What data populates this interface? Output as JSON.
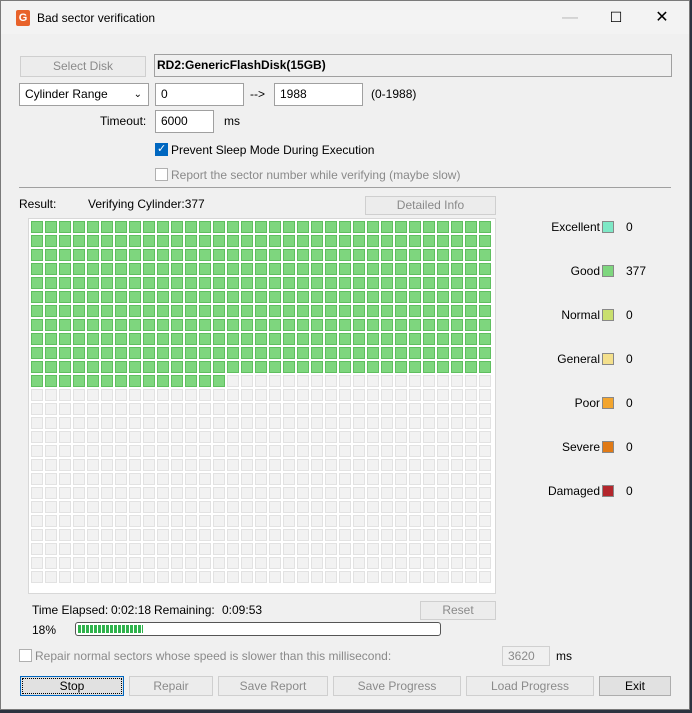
{
  "window": {
    "title": "Bad sector verification"
  },
  "controls": {
    "select_disk": "Select Disk",
    "disk_name": "RD2:GenericFlashDisk(15GB)",
    "range_mode": "Cylinder Range",
    "range_start": "0",
    "arrow": "-->",
    "range_end": "1988",
    "range_hint": "(0-1988)",
    "timeout_label": "Timeout:",
    "timeout_value": "6000",
    "timeout_unit": "ms",
    "prevent_sleep": "Prevent Sleep Mode During Execution",
    "report_sector": "Report the sector number while verifying (maybe slow)"
  },
  "result": {
    "label": "Result:",
    "status": "Verifying Cylinder:377",
    "detailed_info": "Detailed Info",
    "grid": {
      "columns": 33,
      "rows": 26,
      "good_cells": 377
    }
  },
  "legend": [
    {
      "label": "Excellent",
      "count": "0",
      "color": "#7ee8c6"
    },
    {
      "label": "Good",
      "count": "377",
      "color": "#7ed67e"
    },
    {
      "label": "Normal",
      "count": "0",
      "color": "#c9df6e"
    },
    {
      "label": "General",
      "count": "0",
      "color": "#f4e08c"
    },
    {
      "label": "Poor",
      "count": "0",
      "color": "#f3a52e"
    },
    {
      "label": "Severe",
      "count": "0",
      "color": "#e07a16"
    },
    {
      "label": "Damaged",
      "count": "0",
      "color": "#b3262c"
    }
  ],
  "timing": {
    "elapsed_label": "Time Elapsed:",
    "elapsed": "0:02:18",
    "remaining_label": "Remaining:",
    "remaining": "0:09:53",
    "reset": "Reset",
    "percent": "18%",
    "progress_fraction": 0.18
  },
  "repair": {
    "label": "Repair normal sectors whose speed is slower than this millisecond:",
    "value": "3620",
    "unit": "ms"
  },
  "buttons": {
    "stop": "Stop",
    "repair": "Repair",
    "save_report": "Save Report",
    "save_progress": "Save Progress",
    "load_progress": "Load Progress",
    "exit": "Exit"
  }
}
